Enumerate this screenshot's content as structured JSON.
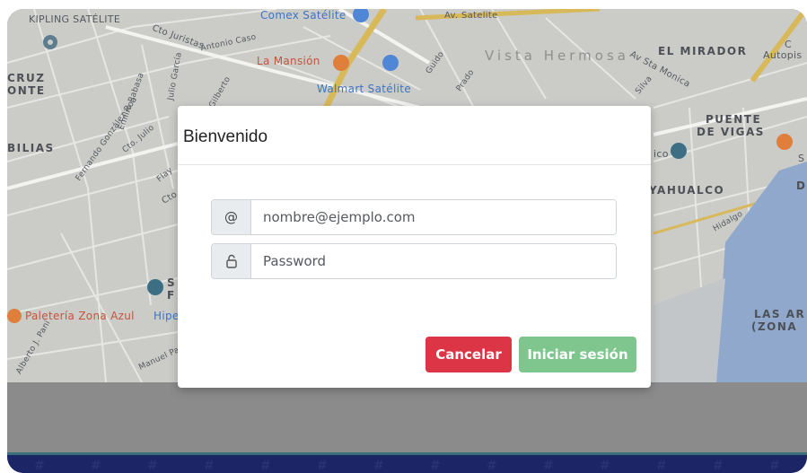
{
  "map": {
    "labels": {
      "kipling": "KIPLING SATÉLITE",
      "comex": "Comex Satélite",
      "av_satelite": "Av. Satelite",
      "cto_juristas": "Cto Juristas",
      "antonio_caso": "Antonio Caso",
      "la_mansion": "La Mansión",
      "walmart": "Walmart Satélite",
      "vista_hermosa": "Vista Hermosa",
      "el_mirador": "EL MIRADOR",
      "autopis": "Autopis",
      "c_partial": "C",
      "av_sta_monica": "Av Sta Monica",
      "cruz": "CRUZ",
      "onte": "ONTE",
      "bilias": "BILIAS",
      "puente": "PUENTE",
      "de_vigas": "DE VIGAS",
      "ico": "ico",
      "s_partial": "S",
      "yahualco": "YAHUALCO",
      "d_partial": "D",
      "paleteria": "Paletería Zona Azul",
      "hipe": "Hipe",
      "sf_partial_s": "S",
      "sf_partial_f": "F",
      "las_ar": "LAS AR",
      "zona": "(ZONA",
      "manuel": "Manuel Pa",
      "alberto": "Alberto J. Pani",
      "cto": "Cto",
      "flay": "Flay",
      "cto_jul": "Cto. Julio",
      "fernando": "Fernando González Roa",
      "emilio": "Emilio Rabasa",
      "julio_garcia": "Julio García",
      "gilberto": "Gilberto",
      "hidalgo": "Hidalgo",
      "silva": "Silva",
      "guido": "Guido",
      "prado": "Prado"
    }
  },
  "modal": {
    "title": "Bienvenido",
    "email": {
      "addon": "@",
      "placeholder": "nombre@ejemplo.com",
      "value": ""
    },
    "password": {
      "addon_icon": "lock-icon",
      "placeholder": "Password",
      "value": ""
    },
    "cancel_label": "Cancelar",
    "login_label": "Iniciar sesión",
    "colors": {
      "cancel": "#dc3545",
      "login": "#7ec58e"
    }
  },
  "footer": {
    "pattern_glyph": "#"
  }
}
